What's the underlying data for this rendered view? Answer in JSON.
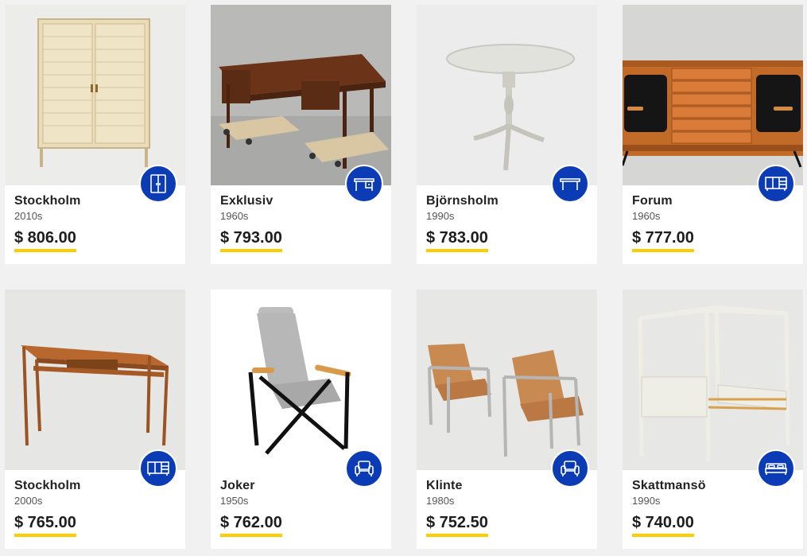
{
  "accent_color": "#0b3bb5",
  "price_underline_color": "#ffcc00",
  "products": [
    {
      "name": "Stockholm",
      "era": "2010s",
      "price": "$ 806.00",
      "category_icon": "cabinet-icon"
    },
    {
      "name": "Exklusiv",
      "era": "1960s",
      "price": "$ 793.00",
      "category_icon": "desk-icon"
    },
    {
      "name": "Björnsholm",
      "era": "1990s",
      "price": "$ 783.00",
      "category_icon": "table-icon"
    },
    {
      "name": "Forum",
      "era": "1960s",
      "price": "$ 777.00",
      "category_icon": "sideboard-icon"
    },
    {
      "name": "Stockholm",
      "era": "2000s",
      "price": "$ 765.00",
      "category_icon": "sideboard-icon"
    },
    {
      "name": "Joker",
      "era": "1950s",
      "price": "$ 762.00",
      "category_icon": "armchair-icon"
    },
    {
      "name": "Klinte",
      "era": "1980s",
      "price": "$ 752.50",
      "category_icon": "armchair-icon"
    },
    {
      "name": "Skattmansö",
      "era": "1990s",
      "price": "$ 740.00",
      "category_icon": "bed-icon"
    }
  ]
}
